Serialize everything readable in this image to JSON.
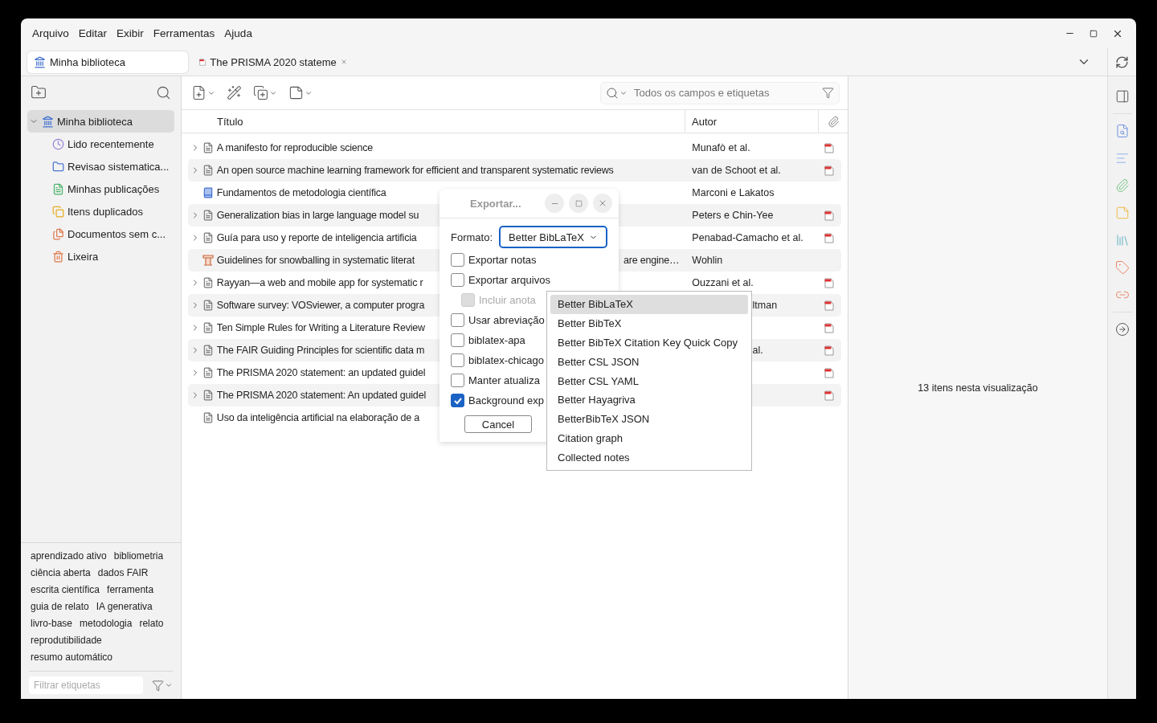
{
  "menu": [
    "Arquivo",
    "Editar",
    "Exibir",
    "Ferramentas",
    "Ajuda"
  ],
  "tabs": [
    {
      "label": "Minha biblioteca",
      "kind": "library",
      "selected": true,
      "closable": false
    },
    {
      "label": "The PRISMA 2020 stateme",
      "kind": "pdf",
      "selected": false,
      "closable": true
    }
  ],
  "collections": {
    "label": "Minha biblioteca",
    "kind": "library",
    "expanded": true,
    "selected": true,
    "children": [
      {
        "label": "Lido recentemente",
        "kind": "recent",
        "selected": false
      },
      {
        "label": "Revisao sistematica...",
        "kind": "folder",
        "selected": false
      },
      {
        "label": "Minhas publicações",
        "kind": "publications",
        "selected": false
      },
      {
        "label": "Itens duplicados",
        "kind": "duplicates",
        "selected": false
      },
      {
        "label": "Documentos sem c...",
        "kind": "unfiled",
        "selected": false
      },
      {
        "label": "Lixeira",
        "kind": "trash",
        "selected": false
      }
    ]
  },
  "tags": [
    "aprendizado ativo",
    "bibliometria",
    "ciência aberta",
    "dados FAIR",
    "escrita científica",
    "ferramenta",
    "guia de relato",
    "IA generativa",
    "livro-base",
    "metodologia",
    "relato",
    "reprodutibilidade",
    "resumo automático"
  ],
  "tag_filter": {
    "placeholder": "Filtrar etiquetas"
  },
  "search": {
    "placeholder": "Todos os campos e etiquetas"
  },
  "table": {
    "columns": [
      "Título",
      "Autor"
    ],
    "rows": [
      {
        "kind": "document",
        "expandable": true,
        "title": "A manifesto for reproducible science",
        "author": "Munafò et al.",
        "attachment": true
      },
      {
        "kind": "document",
        "expandable": true,
        "title": "An open source machine learning framework for efficient and transparent systematic reviews",
        "author": "van de Schoot et al.",
        "attachment": true
      },
      {
        "kind": "book",
        "expandable": false,
        "title": "Fundamentos de metodologia científica",
        "author": "Marconi e Lakatos",
        "attachment": false
      },
      {
        "kind": "document",
        "expandable": true,
        "title": "Generalization bias in large language model su",
        "author": "Peters e Chin-Yee",
        "attachment": true
      },
      {
        "kind": "document",
        "expandable": true,
        "title": "Guía para uso y reporte de inteligencia artificia",
        "author": "Penabad-Camacho et al.",
        "attachment": true
      },
      {
        "kind": "manuscript",
        "expandable": false,
        "title": "Guidelines for snowballing in systematic literat",
        "title_tail": "are engine…",
        "author": "Wohlin",
        "attachment": false
      },
      {
        "kind": "document",
        "expandable": true,
        "title": "Rayyan—a web and mobile app for systematic r",
        "author": "Ouzzani et al.",
        "attachment": true
      },
      {
        "kind": "document",
        "expandable": true,
        "title": "Software survey: VOSviewer, a computer progra",
        "author_tail": "ltman",
        "attachment": true
      },
      {
        "kind": "document",
        "expandable": true,
        "title": "Ten Simple Rules for Writing a Literature Review",
        "attachment": true
      },
      {
        "kind": "document",
        "expandable": true,
        "title": "The FAIR Guiding Principles for scientific data m",
        "author_tail": "al.",
        "attachment": true
      },
      {
        "kind": "document",
        "expandable": true,
        "title": "The PRISMA 2020 statement: an updated guidel",
        "attachment": true
      },
      {
        "kind": "document",
        "expandable": true,
        "title": "The PRISMA 2020 statement: An updated guidel",
        "attachment": true
      },
      {
        "kind": "document",
        "expandable": false,
        "title": "Uso da inteligência artificial na elaboração de a",
        "attachment": false
      }
    ]
  },
  "status": "13 itens nesta visualização",
  "dialog": {
    "title": "Exportar...",
    "format_label": "Formato:",
    "format_value": "Better BibLaTeX",
    "options": [
      {
        "label": "Exportar notas",
        "checked": false,
        "disabled": false
      },
      {
        "label": "Exportar arquivos",
        "checked": false,
        "disabled": false,
        "children": [
          {
            "label": "Incluir anota",
            "checked": false,
            "disabled": true
          }
        ]
      },
      {
        "label": "Usar abreviação",
        "checked": false,
        "disabled": false
      },
      {
        "label": "biblatex-apa",
        "checked": false,
        "disabled": false
      },
      {
        "label": "biblatex-chicago",
        "checked": false,
        "disabled": false
      },
      {
        "label": "Manter atualiza",
        "checked": false,
        "disabled": false
      },
      {
        "label": "Background exp",
        "checked": true,
        "disabled": false
      }
    ],
    "buttons": [
      "Cancel"
    ]
  },
  "dropdown": {
    "items": [
      {
        "label": "Better BibLaTeX",
        "selected": true
      },
      {
        "label": "Better BibTeX",
        "selected": false
      },
      {
        "label": "Better BibTeX Citation Key Quick Copy",
        "selected": false
      },
      {
        "label": "Better CSL JSON",
        "selected": false
      },
      {
        "label": "Better CSL YAML",
        "selected": false
      },
      {
        "label": "Better Hayagriva",
        "selected": false
      },
      {
        "label": "BetterBibTeX JSON",
        "selected": false
      },
      {
        "label": "Citation graph",
        "selected": false
      },
      {
        "label": "Collected notes",
        "selected": false
      }
    ]
  }
}
